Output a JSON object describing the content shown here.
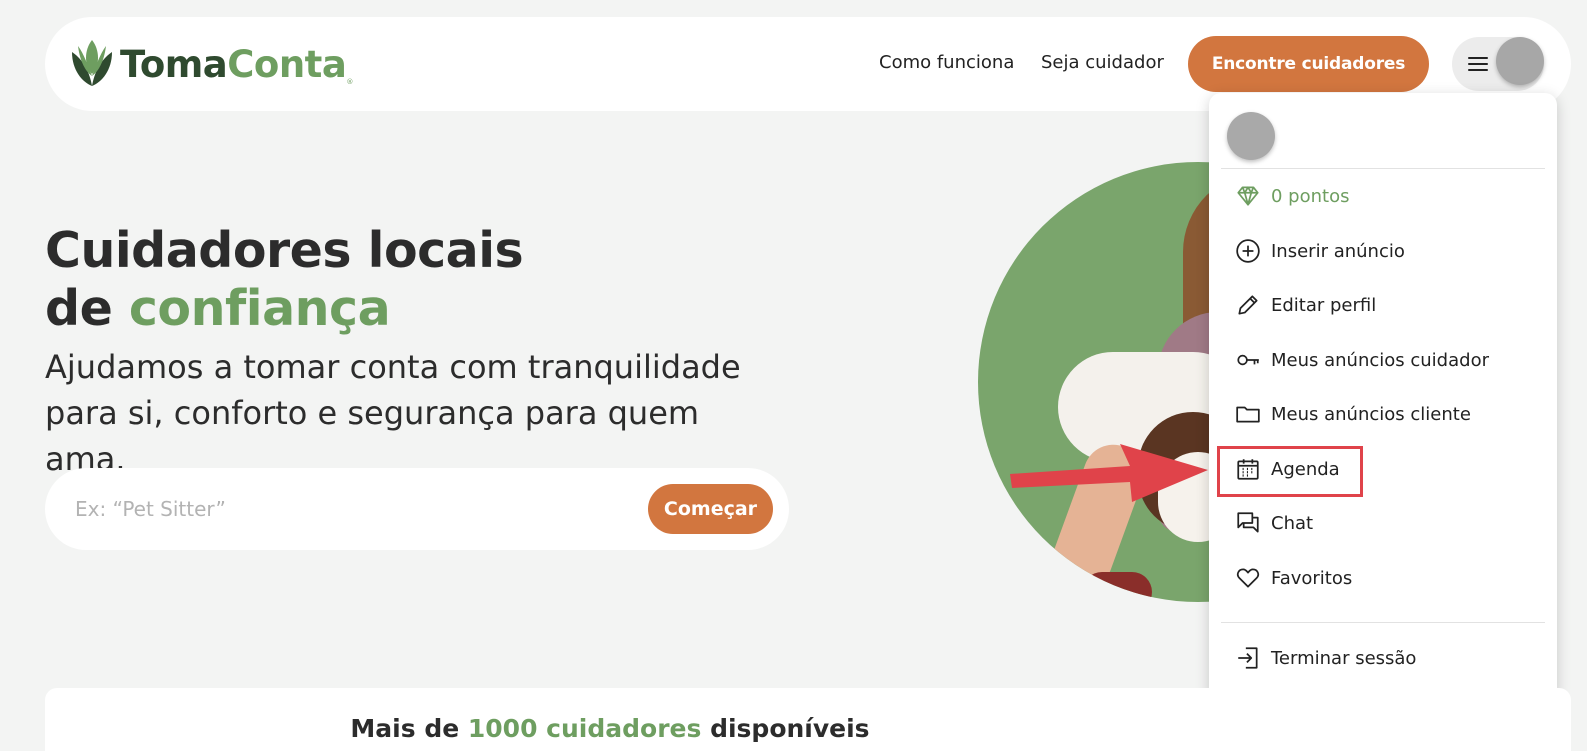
{
  "header": {
    "logo": {
      "part1": "Toma",
      "part2": "Conta",
      "reg": "®"
    },
    "nav": {
      "how_it_works": "Como funciona",
      "be_caregiver": "Seja cuidador"
    },
    "cta_label": "Encontre cuidadores"
  },
  "hero": {
    "title_line1": "Cuidadores locais",
    "title_line2_prefix": "de ",
    "title_line2_highlight": "confiança",
    "subtitle_line1": "Ajudamos a tomar conta com tranquilidade",
    "subtitle_line2": "para si, conforto e segurança para quem ama.",
    "search_placeholder": "Ex: “Pet Sitter”",
    "start_button": "Começar"
  },
  "user_menu": {
    "points": "0 pontos",
    "items": [
      {
        "label": "Inserir anúncio",
        "icon": "plus-circle-icon"
      },
      {
        "label": "Editar perfil",
        "icon": "pencil-icon"
      },
      {
        "label": "Meus anúncios cuidador",
        "icon": "key-icon"
      },
      {
        "label": "Meus anúncios cliente",
        "icon": "folder-icon"
      },
      {
        "label": "Agenda",
        "icon": "calendar-icon"
      },
      {
        "label": "Chat",
        "icon": "chat-icon"
      },
      {
        "label": "Favoritos",
        "icon": "heart-icon"
      }
    ],
    "logout": "Terminar sessão"
  },
  "stats": {
    "prefix": "Mais de ",
    "highlight": "1000 cuidadores",
    "suffix": " disponíveis"
  },
  "colors": {
    "brand_green": "#6e9e60",
    "brand_orange": "#d2763f",
    "annotation_red": "#e0434a"
  }
}
